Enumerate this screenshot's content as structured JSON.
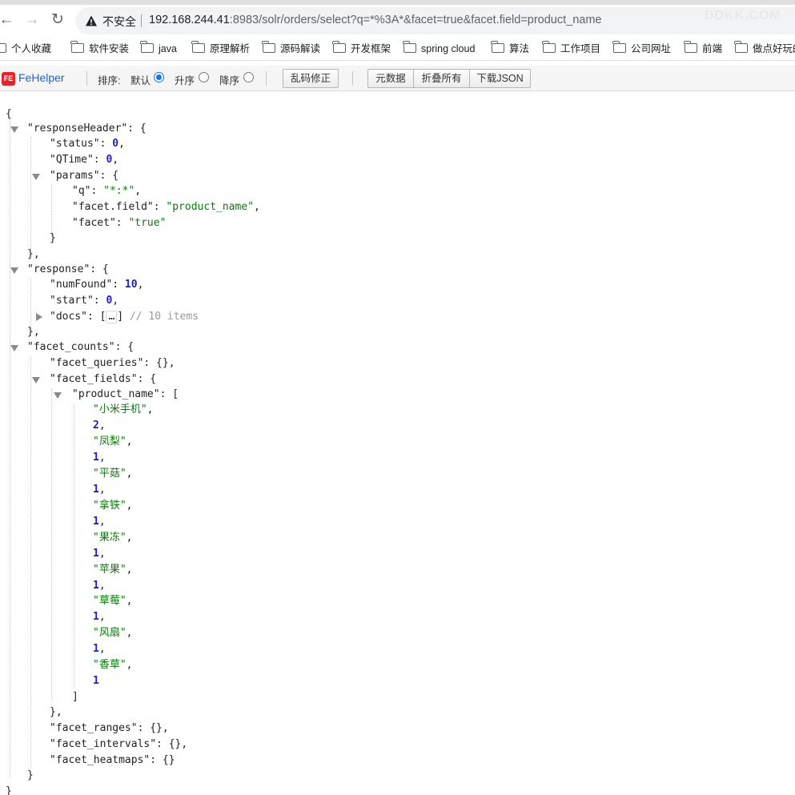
{
  "browser": {
    "insecure_label": "不安全",
    "url_host": "192.168.244.41",
    "url_rest": ":8983/solr/orders/select?q=*%3A*&facet=true&facet.field=product_name",
    "watermark": "DDKK.COM"
  },
  "bookmarks": [
    "个人收藏",
    "软件安装",
    "java",
    "原理解析",
    "源码解读",
    "开发框架",
    "spring cloud",
    "算法",
    "工作项目",
    "公司网址",
    "前端",
    "做点好玩的"
  ],
  "fehelper": {
    "name": "FeHelper",
    "sort_label": "排序:",
    "sort_options": [
      "默认",
      "升序",
      "降序"
    ],
    "selected_sort": "默认",
    "fix_encoding": "乱码修正",
    "metadata": "元数据",
    "collapse_all": "折叠所有",
    "download_json": "下载JSON"
  },
  "json": {
    "status": 0,
    "qtime": 0,
    "params": {
      "q": "\"*:*\"",
      "facet_field": "\"product_name\"",
      "facet": "\"true\""
    },
    "num_found": 10,
    "start": 0,
    "docs_ellipsis": "…",
    "docs_comment": "// 10 items",
    "product_name_facets": [
      {
        "name": "\"小米手机\"",
        "count": 2
      },
      {
        "name": "\"凤梨\"",
        "count": 1
      },
      {
        "name": "\"平菇\"",
        "count": 1
      },
      {
        "name": "\"拿铁\"",
        "count": 1
      },
      {
        "name": "\"果冻\"",
        "count": 1
      },
      {
        "name": "\"苹果\"",
        "count": 1
      },
      {
        "name": "\"草莓\"",
        "count": 1
      },
      {
        "name": "\"风扇\"",
        "count": 1
      },
      {
        "name": "\"香草\"",
        "count": 1
      }
    ]
  }
}
